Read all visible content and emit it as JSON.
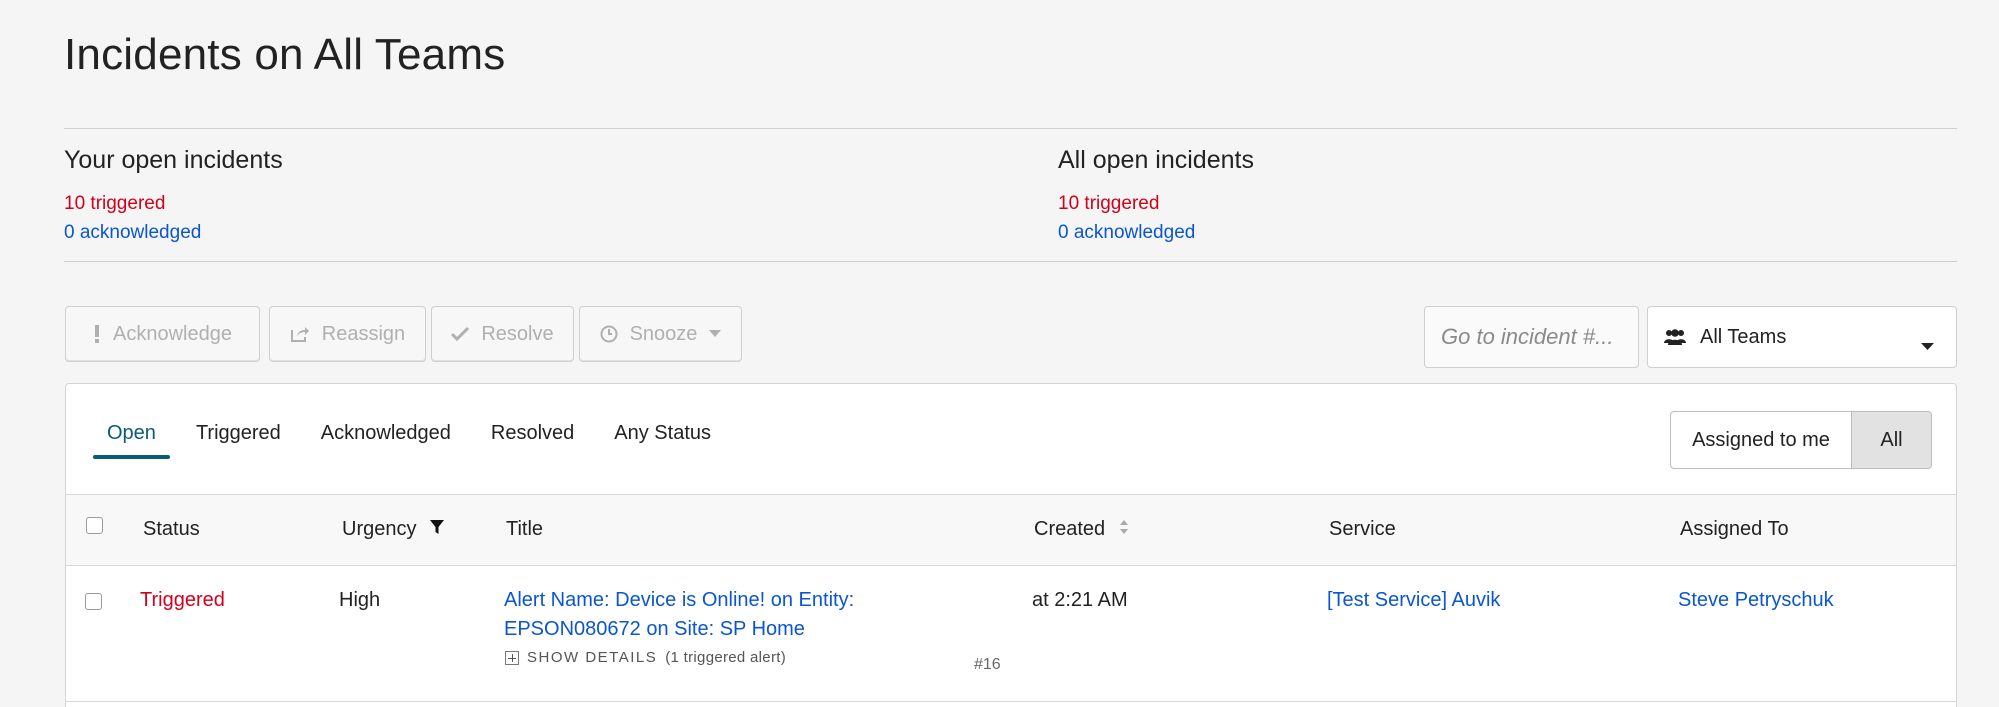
{
  "page": {
    "title": "Incidents on All Teams"
  },
  "summary": {
    "yours": {
      "heading": "Your open incidents",
      "triggered": "10 triggered",
      "acknowledged": "0 acknowledged"
    },
    "all": {
      "heading": "All open incidents",
      "triggered": "10 triggered",
      "acknowledged": "0 acknowledged"
    }
  },
  "toolbar": {
    "acknowledge": "Acknowledge",
    "reassign": "Reassign",
    "resolve": "Resolve",
    "snooze": "Snooze",
    "goto_placeholder": "Go to incident #...",
    "teams_selected": "All Teams"
  },
  "tabs": [
    {
      "label": "Open",
      "active": true
    },
    {
      "label": "Triggered"
    },
    {
      "label": "Acknowledged"
    },
    {
      "label": "Resolved"
    },
    {
      "label": "Any Status"
    }
  ],
  "assign_toggle": {
    "mine": "Assigned to me",
    "all": "All",
    "selected": "All"
  },
  "table": {
    "headers": {
      "status": "Status",
      "urgency": "Urgency",
      "title": "Title",
      "created": "Created",
      "service": "Service",
      "assigned": "Assigned To"
    },
    "rows": [
      {
        "status": "Triggered",
        "urgency": "High",
        "title_line1": "Alert Name: Device is Online! on Entity:",
        "title_line2": "EPSON080672 on Site: SP Home",
        "details_label": "SHOW DETAILS",
        "details_count": "(1 triggered alert)",
        "number": "#16",
        "created": "at 2:21 AM",
        "service": "[Test Service] Auvik",
        "assigned_to": "Steve Petryschuk"
      }
    ]
  },
  "colors": {
    "triggered": "#d0021b",
    "link": "#0b56d0",
    "active_tab": "#0a5a7a"
  },
  "icons": {
    "acknowledge": "exclamation-icon",
    "reassign": "share-icon",
    "resolve": "checkmark-icon",
    "snooze": "clock-icon",
    "teams": "users-icon",
    "urgency_filter": "filter-icon",
    "created_sort": "sort-icon"
  }
}
